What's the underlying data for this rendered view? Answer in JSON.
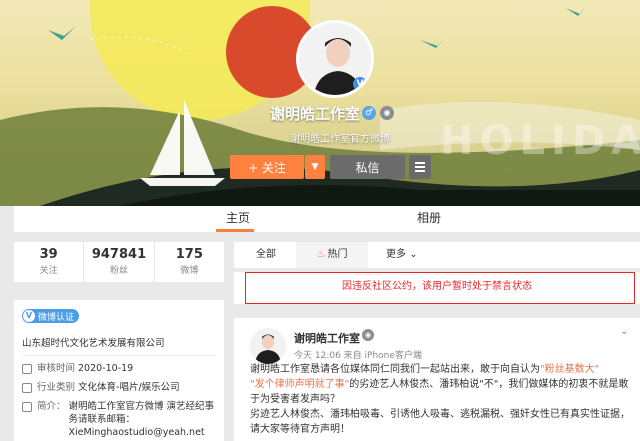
{
  "profile": {
    "name": "谢明皓工作室",
    "subtitle": "谢明皓工作室官方微博",
    "follow_label": "+ 关注",
    "message_label": "私信"
  },
  "cover": {
    "watermark": "HOLIDAY"
  },
  "tabs": {
    "home": "主页",
    "album": "相册"
  },
  "stats": [
    {
      "value": "39",
      "label": "关注"
    },
    {
      "value": "947841",
      "label": "粉丝"
    },
    {
      "value": "175",
      "label": "微博"
    }
  ],
  "info": {
    "auth_badge": "微博认证",
    "company": "山东超时代文化艺术发展有限公司",
    "review_label": "审核时间",
    "review_value": "2020-10-19",
    "industry_label": "行业类别",
    "industry_value": "文化体育-唱片/娱乐公司",
    "intro_label": "简介：",
    "intro_value": "谢明皓工作室官方微博 演艺经纪事务请联系邮箱：XieMinghaostudio@yeah.net"
  },
  "filters": {
    "all": "全部",
    "hot": "热门",
    "more": "更多"
  },
  "notice": "因违反社区公约，该用户暂时处于禁言状态",
  "post": {
    "author": "谢明皓工作室",
    "meta": "今天 12:06 来自 iPhone客户端",
    "p1_a": "谢明皓工作室恳请各位媒体同仁同我们一起站出来，敢于向自认为",
    "p1_link1": "\"粉丝基数大\"",
    "p1_link2": "\"发个律师声明就了事\"",
    "p1_b": "的劣迹艺人林俊杰、潘玮柏说\"不\"，我们做媒体的初衷不就是敢于为受害者发声吗？",
    "p2": "劣迹艺人林俊杰、潘玮柏吸毒、引诱他人吸毒、逃税漏税、强奸女性已有真实性证据，请大家等待官方声明！"
  },
  "colors": {
    "accent": "#ff8140",
    "tab_underline": "#fa7d3c",
    "notice_red": "#e8262a",
    "link": "#eb7350",
    "verify_blue": "#3d8ee6"
  }
}
